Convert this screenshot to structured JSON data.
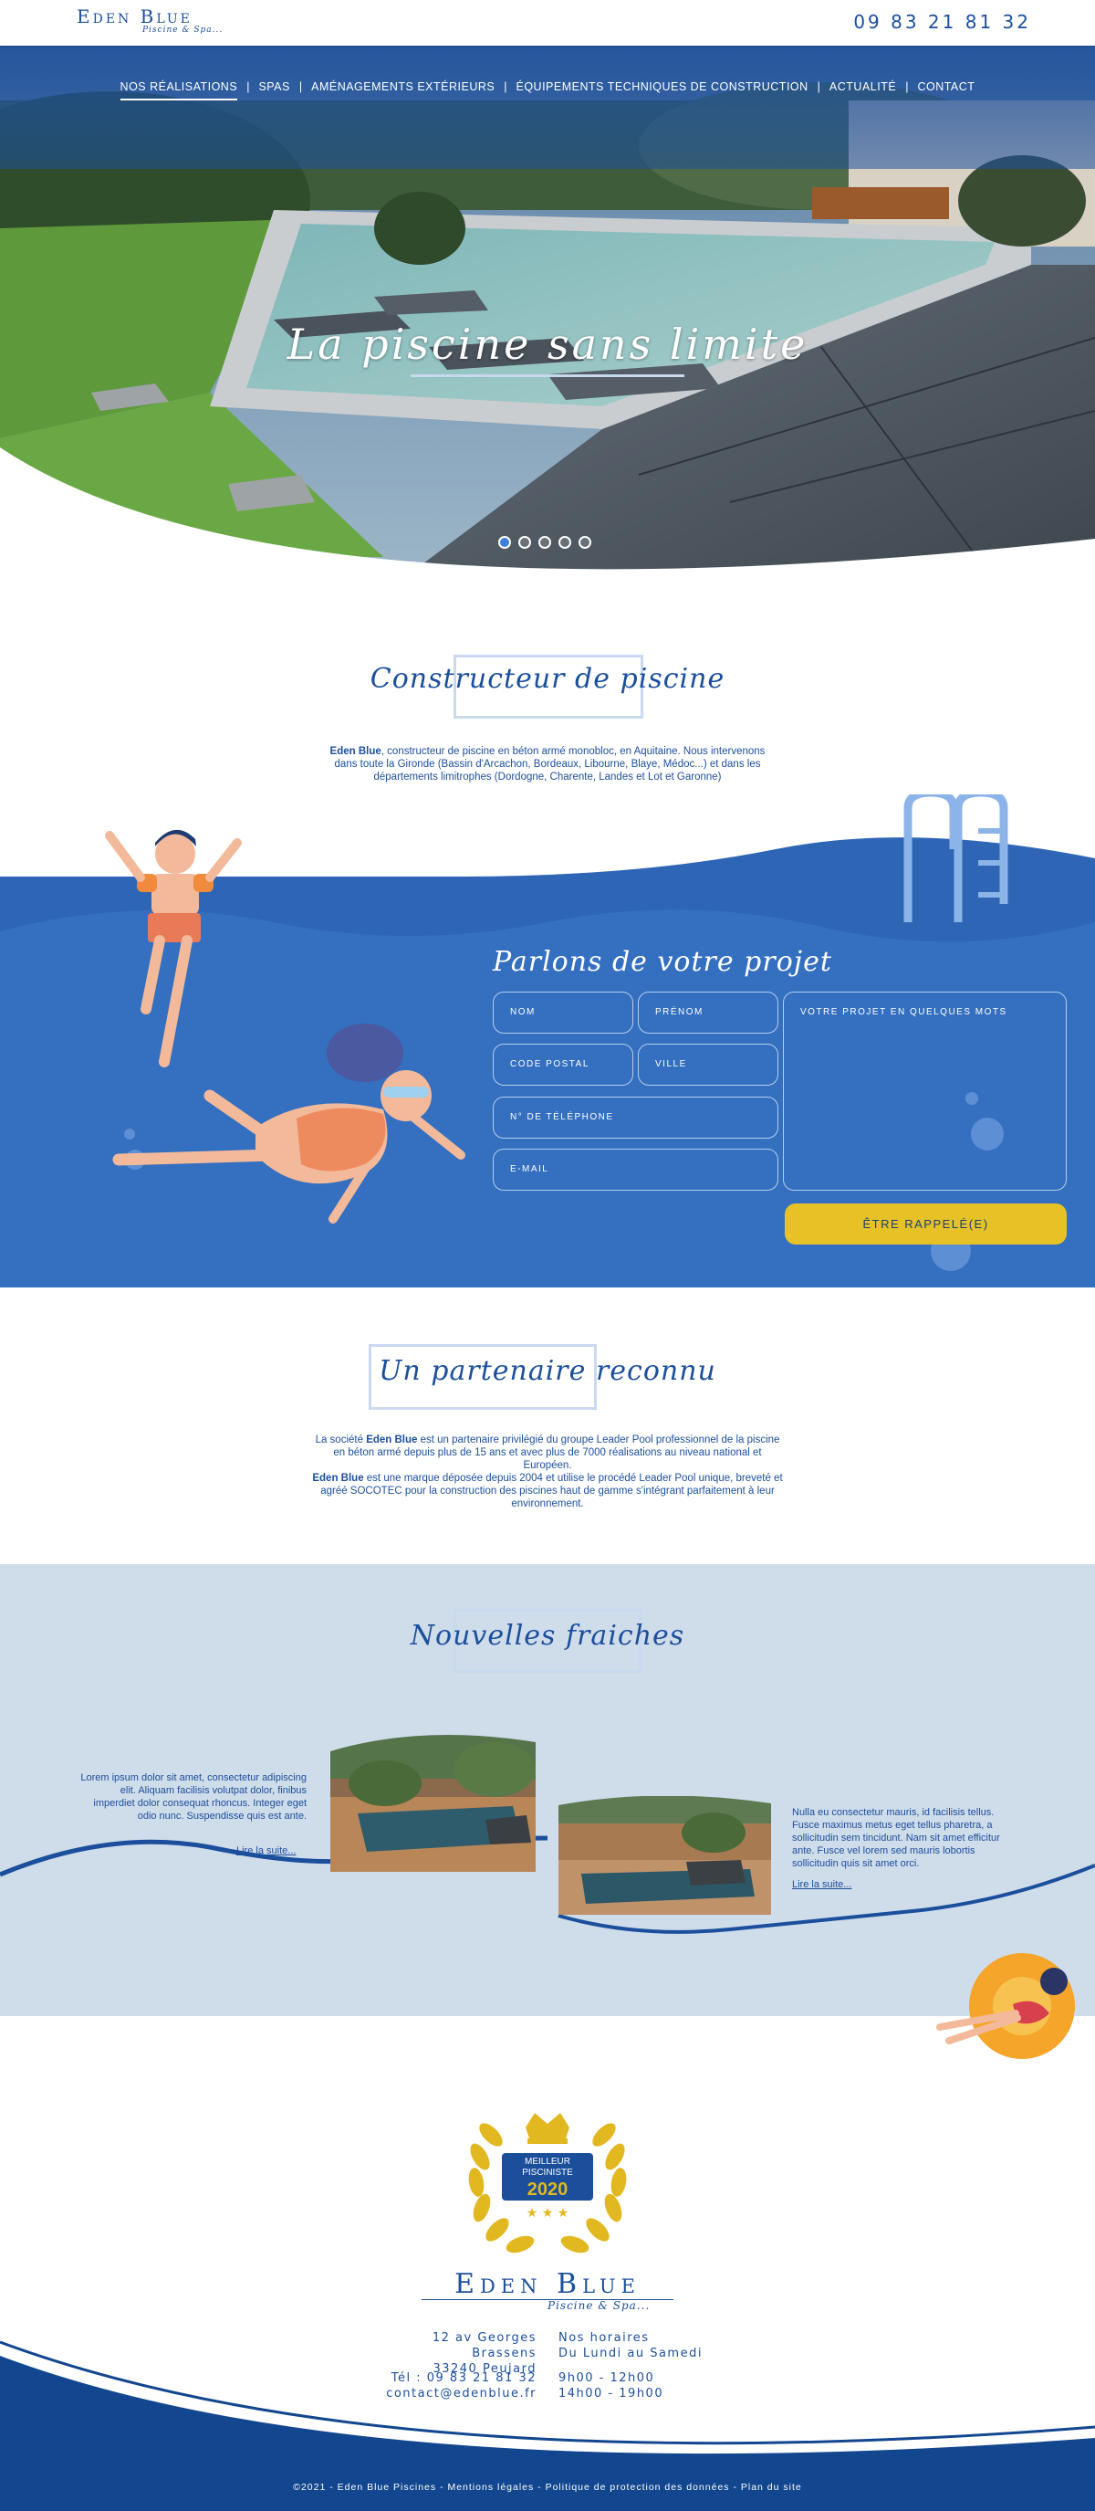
{
  "header": {
    "logo_name": "Eden Blue",
    "logo_tagline": "Piscine & Spa...",
    "phone": "09 83 21 81 32"
  },
  "nav": {
    "items": [
      {
        "label": "NOS RÉALISATIONS",
        "active": true
      },
      {
        "label": "SPAS"
      },
      {
        "label": "AMÉNAGEMENTS EXTÉRIEURS"
      },
      {
        "label": "ÉQUIPEMENTS TECHNIQUES DE CONSTRUCTION"
      },
      {
        "label": "ACTUALITÉ"
      },
      {
        "label": "CONTACT"
      }
    ],
    "separator": "|"
  },
  "hero": {
    "title": "La piscine sans limite",
    "slide_count": 5,
    "active_slide": 1
  },
  "constructor": {
    "title": "Constructeur de piscine",
    "brand": "Eden Blue",
    "text": ", constructeur de piscine en béton armé monobloc, en Aquitaine. Nous intervenons dans toute la Gironde (Bassin d'Arcachon, Bordeaux, Libourne, Blaye, Médoc...) et dans les départements limitrophes (Dordogne, Charente, Landes et Lot et Garonne)"
  },
  "form": {
    "title": "Parlons de votre projet",
    "fields": {
      "nom": "NOM",
      "prenom": "PRÉNOM",
      "code_postal": "CODE POSTAL",
      "ville": "VILLE",
      "telephone": "N° DE TÉLÉPHONE",
      "email": "E-MAIL",
      "projet": "VOTRE PROJET EN QUELQUES MOTS"
    },
    "submit": "ÊTRE RAPPELÉ(E)"
  },
  "partner": {
    "title": "Un partenaire reconnu",
    "line1_pre": "La société ",
    "brand": "Eden Blue",
    "line1_post": " est un partenaire privilégié du groupe Leader Pool professionnel de la piscine en béton armé depuis plus de 15 ans et avec plus de 7000 réalisations au niveau national et Européen.",
    "line2_post": " est une marque déposée depuis 2004 et utilise le procédé Leader Pool unique, breveté et agréé SOCOTEC pour la construction des piscines haut de gamme s'intégrant parfaitement à leur environnement."
  },
  "news": {
    "title": "Nouvelles fraiches",
    "items": [
      {
        "text": "Lorem ipsum dolor sit amet, consectetur adipiscing elit. Aliquam facilisis volutpat dolor, finibus imperdiet dolor consequat rhoncus. Integer eget odio nunc. Suspendisse quis est ante.",
        "link": "Lire la suite..."
      },
      {
        "text": "Nulla eu consectetur mauris, id facilisis tellus. Fusce maximus metus eget tellus pharetra, a sollicitudin sem tincidunt. Nam sit amet efficitur ante. Fusce vel lorem sed mauris lobortis sollicitudin quis sit amet orci.",
        "link": "Lire la suite..."
      }
    ]
  },
  "award": {
    "line1": "MEILLEUR",
    "line2": "PISCINISTE",
    "year": "2020"
  },
  "footer": {
    "logo_name": "Eden Blue",
    "logo_tagline": "Piscine & Spa...",
    "address_line1": "12 av Georges Brassens",
    "address_line2": "33240 Peujard",
    "hours_title": "Nos horaires",
    "hours_days": "Du Lundi au Samedi",
    "tel": "Tél : 09 83 21 81 32",
    "email": "contact@edenblue.fr",
    "hours_am": "9h00 - 12h00",
    "hours_pm": "14h00 - 19h00",
    "bottom_links": "©2021 - Eden Blue Piscines - Mentions légales - Politique de protection des données - Plan du site"
  },
  "colors": {
    "brand_blue": "#1b4f9c",
    "form_bg": "#2e66b5",
    "news_bg": "#cfdcea",
    "cta_yellow": "#e6c227"
  }
}
